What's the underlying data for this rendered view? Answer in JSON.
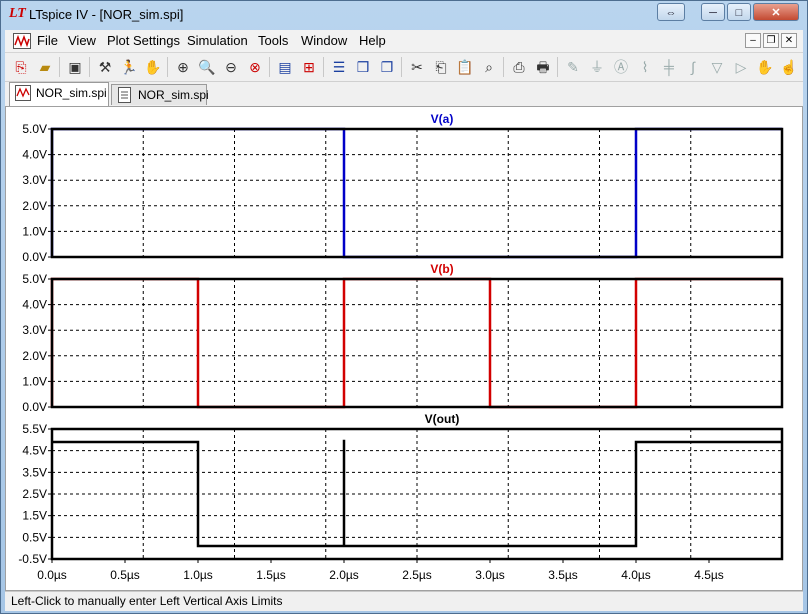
{
  "window": {
    "app_name": "LTspice IV",
    "title": "LTspice IV - [NOR_sim.spi]",
    "controls": {
      "restore_glyph": "⇔",
      "minimize": "─",
      "maximize": "□",
      "close": "✕"
    }
  },
  "menu": {
    "items": [
      "File",
      "View",
      "Plot Settings",
      "Simulation",
      "Tools",
      "Window",
      "Help"
    ],
    "mdi_controls": [
      "–",
      "❐",
      "✕"
    ]
  },
  "toolbar": {
    "icons": [
      "open-schematic-icon",
      "open-folder-icon",
      "save-icon",
      "control-panel-icon",
      "run-icon",
      "pan-hand-icon",
      "zoom-in-icon",
      "zoom-area-icon",
      "zoom-out-icon",
      "zoom-fit-icon",
      "autorange-icon",
      "waveform-options-icon",
      "tile-horizontal-icon",
      "cascade-icon",
      "tile-vertical-icon",
      "cut-icon",
      "copy-icon",
      "paste-icon",
      "find-icon",
      "print-preview-icon",
      "print-icon",
      "draw-wire-icon",
      "ground-icon",
      "label-net-icon",
      "resistor-icon",
      "capacitor-icon",
      "inductor-icon",
      "diode-icon",
      "component-icon",
      "move-icon",
      "drag-icon"
    ]
  },
  "tabs": [
    {
      "label": "NOR_sim.spi",
      "active": true,
      "icon": "waveform-tab-icon"
    },
    {
      "label": "NOR_sim.spi",
      "active": false,
      "icon": "netlist-tab-icon"
    }
  ],
  "status": {
    "text": "Left-Click to manually enter Left Vertical Axis Limits"
  },
  "chart_data": [
    {
      "type": "line",
      "title": "V(a)",
      "color": "#0000c8",
      "y_ticks": [
        "5.0V",
        "4.0V",
        "3.0V",
        "2.0V",
        "1.0V",
        "0.0V"
      ],
      "ylim": [
        0,
        5
      ],
      "x": [
        0,
        0,
        2,
        2,
        4,
        4,
        5
      ],
      "y": [
        0,
        5,
        5,
        0,
        0,
        5,
        5
      ],
      "series": [
        {
          "name": "V(a)",
          "x": [
            0,
            0,
            2,
            2,
            4,
            4,
            5
          ],
          "y": [
            0,
            5,
            5,
            0,
            0,
            5,
            5
          ]
        }
      ]
    },
    {
      "type": "line",
      "title": "V(b)",
      "color": "#d20000",
      "y_ticks": [
        "5.0V",
        "4.0V",
        "3.0V",
        "2.0V",
        "1.0V",
        "0.0V"
      ],
      "ylim": [
        0,
        5
      ],
      "series": [
        {
          "name": "V(b)",
          "x": [
            0,
            0,
            1,
            1,
            2,
            2,
            3,
            3,
            4,
            4,
            5
          ],
          "y": [
            0,
            5,
            5,
            0,
            0,
            5,
            5,
            0,
            0,
            5,
            5
          ]
        }
      ]
    },
    {
      "type": "line",
      "title": "V(out)",
      "color": "#000000",
      "y_ticks": [
        "5.5V",
        "4.5V",
        "3.5V",
        "2.5V",
        "1.5V",
        "0.5V",
        "-0.5V"
      ],
      "ylim": [
        -0.5,
        5.5
      ],
      "series": [
        {
          "name": "V(out)",
          "x": [
            0,
            0,
            1,
            1,
            2,
            2,
            2,
            4,
            4,
            5
          ],
          "y": [
            4.9,
            4.9,
            4.9,
            0.1,
            0.1,
            5.0,
            0.1,
            0.1,
            4.9,
            4.9
          ]
        }
      ]
    }
  ],
  "x_axis": {
    "ticks": [
      "0.0µs",
      "0.5µs",
      "1.0µs",
      "1.5µs",
      "2.0µs",
      "2.5µs",
      "3.0µs",
      "3.5µs",
      "4.0µs",
      "4.5µs"
    ],
    "range": [
      0,
      5
    ]
  }
}
